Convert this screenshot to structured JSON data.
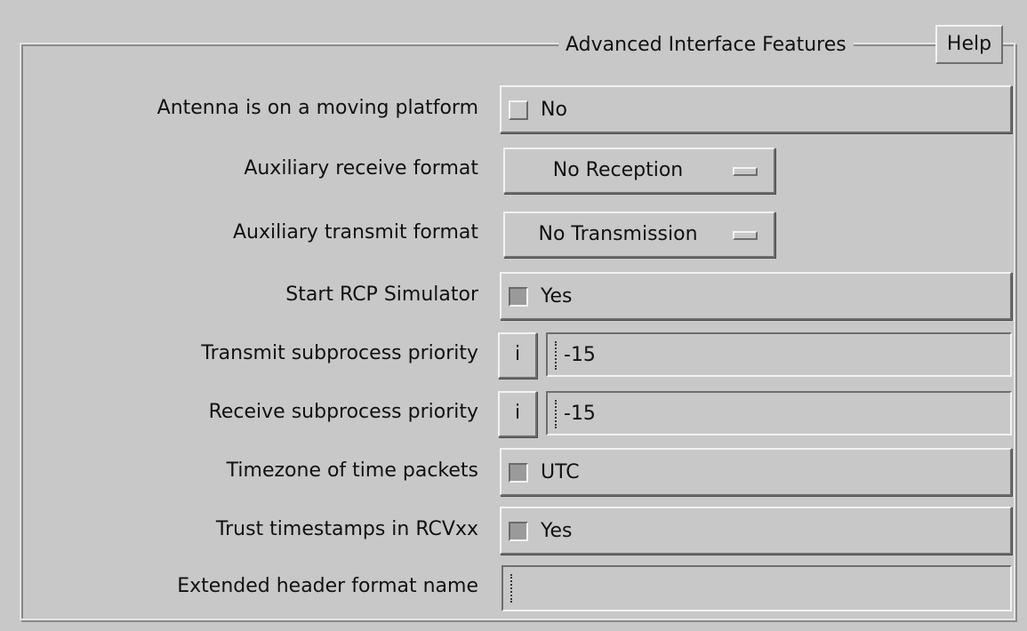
{
  "frame": {
    "title": "Advanced Interface Features",
    "help_label": "Help"
  },
  "fields": {
    "moving_platform": {
      "label": "Antenna is on a moving platform",
      "value": "No",
      "checked": false
    },
    "aux_receive": {
      "label": "Auxiliary receive format",
      "value": "No Reception"
    },
    "aux_transmit": {
      "label": "Auxiliary transmit format",
      "value": "No Transmission"
    },
    "rcp_simulator": {
      "label": "Start RCP Simulator",
      "value": "Yes",
      "checked": true
    },
    "transmit_priority": {
      "label": "Transmit subprocess priority",
      "info_label": "i",
      "value": "-15"
    },
    "receive_priority": {
      "label": "Receive subprocess priority",
      "info_label": "i",
      "value": "-15"
    },
    "timezone": {
      "label": "Timezone of time packets",
      "value": "UTC",
      "checked": true
    },
    "trust_timestamps": {
      "label": "Trust timestamps in RCVxx",
      "value": "Yes",
      "checked": true
    },
    "ext_header": {
      "label": "Extended header format name",
      "value": ""
    }
  }
}
